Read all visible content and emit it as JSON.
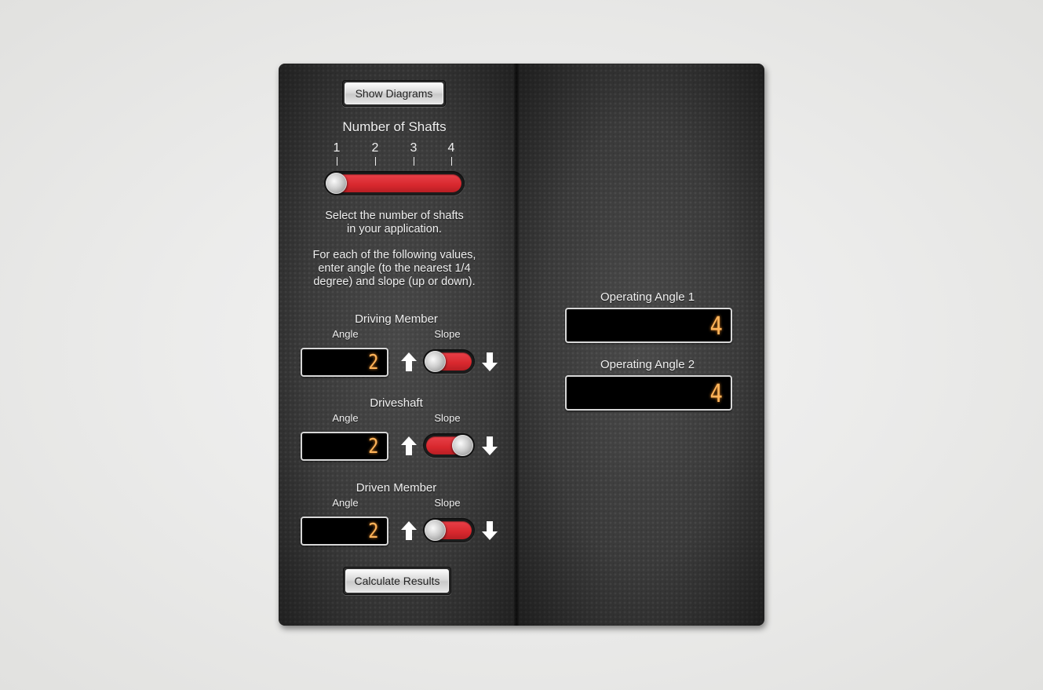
{
  "left_panel": {
    "show_diagrams_label": "Show Diagrams",
    "shafts_title": "Number of Shafts",
    "shaft_ticks": [
      "1",
      "2",
      "3",
      "4"
    ],
    "shaft_slider": {
      "min": 1,
      "max": 4,
      "value": 1
    },
    "instructions_1": [
      "Select the number of shafts",
      "in your application."
    ],
    "instructions_2": [
      "For each of the following values,",
      "enter angle (to the nearest 1/4",
      "degree) and slope (up or down)."
    ],
    "members": [
      {
        "title": "Driving Member",
        "angle_label": "Angle",
        "slope_label": "Slope",
        "angle_value": "2",
        "slope": "up"
      },
      {
        "title": "Driveshaft",
        "angle_label": "Angle",
        "slope_label": "Slope",
        "angle_value": "2",
        "slope": "down"
      },
      {
        "title": "Driven Member",
        "angle_label": "Angle",
        "slope_label": "Slope",
        "angle_value": "2",
        "slope": "up"
      }
    ],
    "calculate_label": "Calculate Results"
  },
  "right_panel": {
    "results": [
      {
        "label": "Operating Angle 1",
        "value": "4"
      },
      {
        "label": "Operating Angle 2",
        "value": "4"
      }
    ]
  },
  "colors": {
    "accent_red": "#e03036",
    "lcd_digit": "#ffb45a",
    "panel_bg": "#3a3a3a"
  }
}
